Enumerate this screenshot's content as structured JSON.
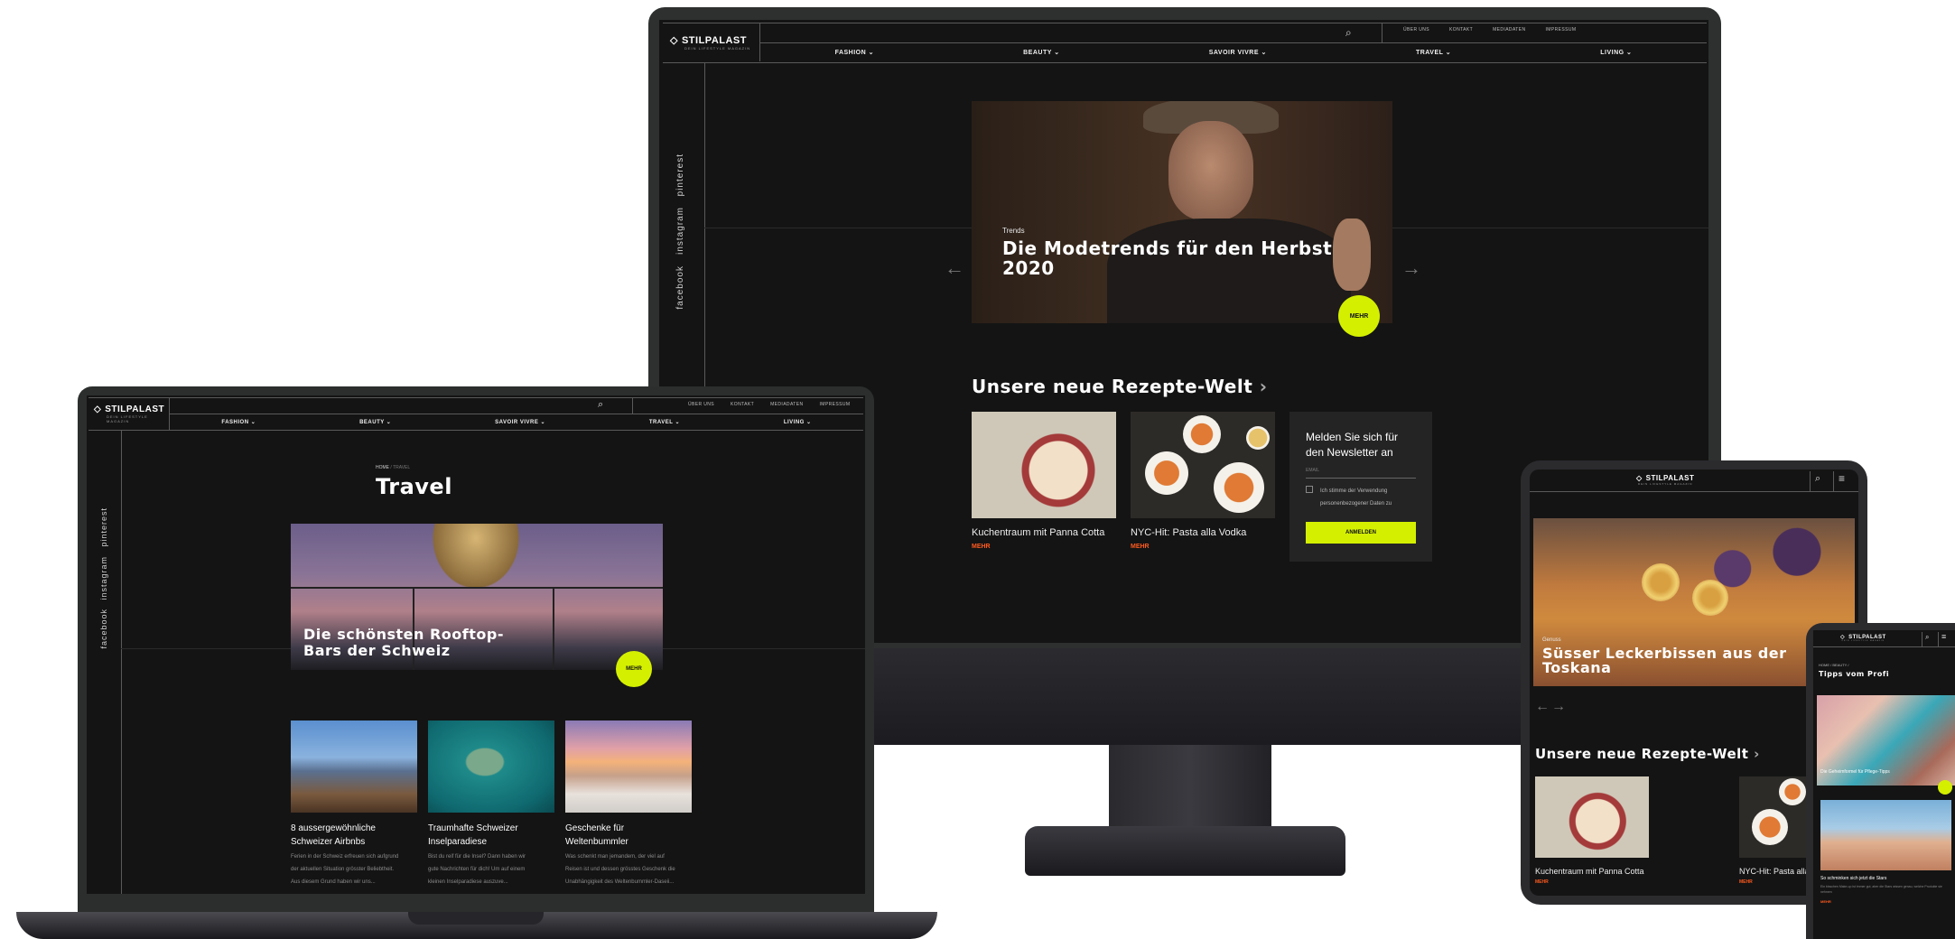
{
  "brand": {
    "name": "STILPALAST",
    "tagline": "DEIN LIFESTYLE MAGAZIN"
  },
  "colors": {
    "background": "#141414",
    "accent_lime": "#d4f000",
    "accent_orange": "#ff5a1f",
    "divider": "#5a5a5a"
  },
  "nav": {
    "items": [
      "FASHION",
      "BEAUTY",
      "SAVOIR VIVRE",
      "TRAVEL",
      "LIVING"
    ],
    "utility": [
      "ÜBER UNS",
      "KONTAKT",
      "MEDIADATEN",
      "IMPRESSUM"
    ]
  },
  "social": [
    "pinterest",
    "instagram",
    "facebook"
  ],
  "monitor": {
    "hero": {
      "category": "Trends",
      "title_line1": "Die Modetrends für den Herbst",
      "title_line2": "2020",
      "badge": "MEHR"
    },
    "recipes_heading": "Unsere neue Rezepte-Welt",
    "cards": [
      {
        "title": "Kuchentraum mit Panna Cotta",
        "link": "MEHR"
      },
      {
        "title": "NYC-Hit: Pasta alla Vodka",
        "link": "MEHR"
      }
    ],
    "newsletter": {
      "title_line1": "Melden Sie sich für",
      "title_line2": "den Newsletter an",
      "email_placeholder": "EMAIL",
      "consent_line1": "Ich stimme der Verwendung",
      "consent_line2": "personenbezogener Daten zu",
      "button": "ANMELDEN"
    }
  },
  "laptop": {
    "breadcrumb_home": "HOME",
    "breadcrumb_sep": "/",
    "breadcrumb_current": "TRAVEL",
    "page_title": "Travel",
    "hero": {
      "title_line1": "Die schönsten Rooftop-",
      "title_line2": "Bars der Schweiz",
      "badge": "MEHR"
    },
    "cards": [
      {
        "title_line1": "8 aussergewöhnliche",
        "title_line2": "Schweizer Airbnbs",
        "text_line1": "Ferien in der Schweiz erfreuen sich aufgrund",
        "text_line2": "der aktuellen Situation grösster Beliebtheit.",
        "text_line3": "Aus diesem Grund haben wir uns..."
      },
      {
        "title_line1": "Traumhafte Schweizer",
        "title_line2": "Inselparadiese",
        "text_line1": "Bist du reif für die Insel? Dann haben wir",
        "text_line2": "gute Nachrichten für dich! Um auf einem",
        "text_line3": "kleinen Inselparadiese auszuve..."
      },
      {
        "title_line1": "Geschenke für",
        "title_line2": "Weltenbummler",
        "text_line1": "Was schenkt man jemandem, der viel auf",
        "text_line2": "Reisen ist und dessen grösstes Geschenk die",
        "text_line3": "Unabhängigkeit des Weltenbummler-Daseii..."
      }
    ]
  },
  "tablet": {
    "hero": {
      "category": "Genuss",
      "title_line1": "Süsser Leckerbissen aus der",
      "title_line2": "Toskana"
    },
    "recipes_heading": "Unsere neue Rezepte-Welt",
    "cards": [
      {
        "title": "Kuchentraum mit Panna Cotta",
        "link": "MEHR"
      },
      {
        "title": "NYC-Hit: Pasta alla V",
        "link": "MEHR"
      }
    ]
  },
  "phone": {
    "breadcrumb": "HOME / BEAUTY /",
    "page_title": "Tipps vom Profi",
    "card1_title": "Die Geheimformel für Pflege-Tipps",
    "card2_title": "So schminken sich jetzt die Stars",
    "card2_text": "Ein bisschen Make-up ist immer gut, aber die Stars wissen genau, welche Produkte sie nehmen",
    "card2_link": "MEHR"
  }
}
